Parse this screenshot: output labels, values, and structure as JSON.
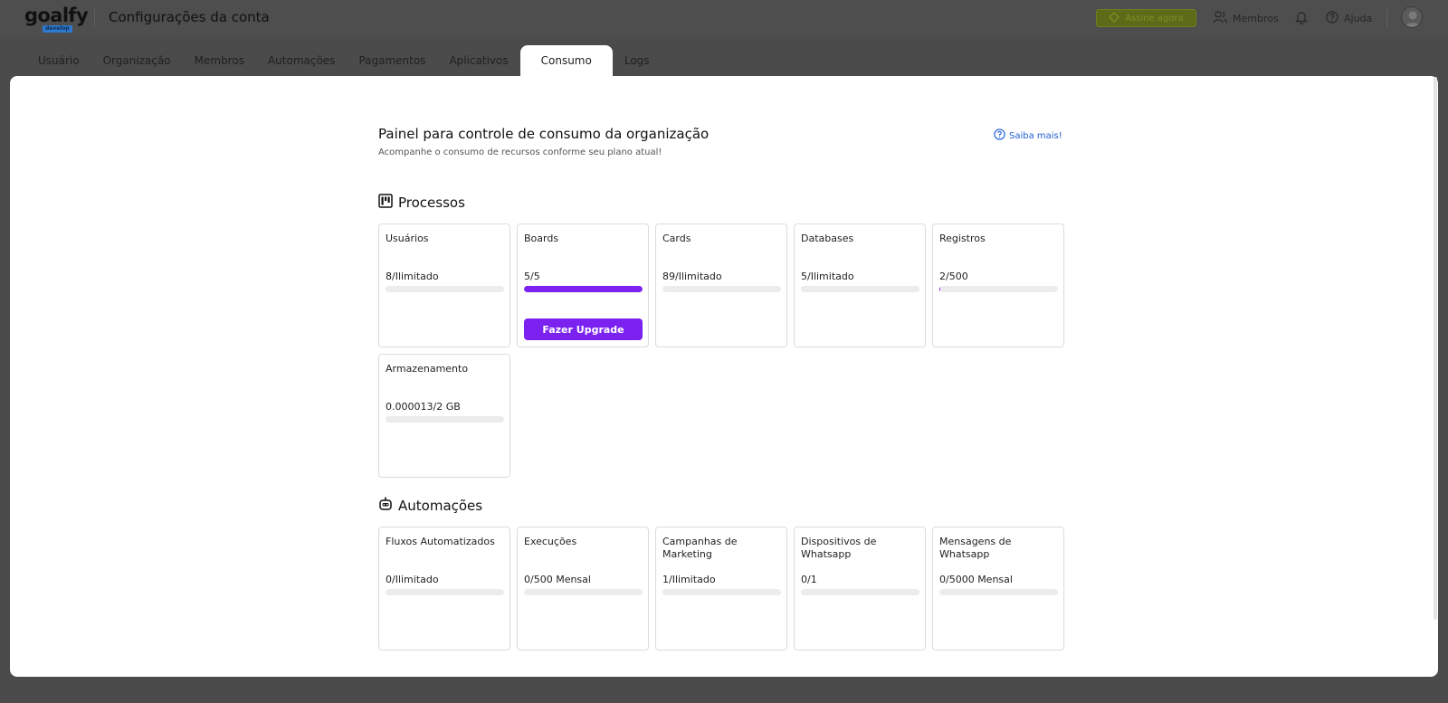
{
  "topbar": {
    "logo_text": "goalfy",
    "logo_badge": "develop",
    "title": "Configurações da conta",
    "subscribe_label": "Assine agora",
    "members_label": "Membros",
    "help_label": "Ajuda"
  },
  "tabs": [
    {
      "label": "Usuário",
      "active": false
    },
    {
      "label": "Organização",
      "active": false
    },
    {
      "label": "Membros",
      "active": false
    },
    {
      "label": "Automações",
      "active": false
    },
    {
      "label": "Pagamentos",
      "active": false
    },
    {
      "label": "Aplicativos",
      "active": false
    },
    {
      "label": "Consumo",
      "active": true
    },
    {
      "label": "Logs",
      "active": false
    }
  ],
  "page": {
    "title": "Painel para controle de consumo da organização",
    "subtitle": "Acompanhe o consumo de recursos conforme seu plano atual!",
    "learn_more": "Saiba mais!"
  },
  "colors": {
    "accent": "#7b22f0",
    "link": "#1f5fd6"
  },
  "sections": {
    "processes": {
      "title": "Processos",
      "icon": "kanban-board-icon",
      "cards": [
        {
          "title": "Usuários",
          "value": "8/Ilimitado",
          "fill": 0.0
        },
        {
          "title": "Boards",
          "value": "5/5",
          "fill": 1.0,
          "button": "Fazer Upgrade"
        },
        {
          "title": "Cards",
          "value": "89/Ilimitado",
          "fill": 0.0
        },
        {
          "title": "Databases",
          "value": "5/Ilimitado",
          "fill": 0.0
        },
        {
          "title": "Registros",
          "value": "2/500",
          "fill": 0.004
        },
        {
          "title": "Armazenamento",
          "value": "0.000013/2 GB",
          "fill": 0.0
        }
      ]
    },
    "automations": {
      "title": "Automações",
      "icon": "robot-icon",
      "cards": [
        {
          "title": "Fluxos Automatizados",
          "value": "0/Ilimitado",
          "fill": 0.0
        },
        {
          "title": "Execuções",
          "value": "0/500 Mensal",
          "fill": 0.0
        },
        {
          "title": "Campanhas de Marketing",
          "value": "1/Ilimitado",
          "fill": 0.0
        },
        {
          "title": "Dispositivos de Whatsapp",
          "value": "0/1",
          "fill": 0.0
        },
        {
          "title": "Mensagens de Whatsapp",
          "value": "0/5000 Mensal",
          "fill": 0.0
        }
      ]
    }
  }
}
